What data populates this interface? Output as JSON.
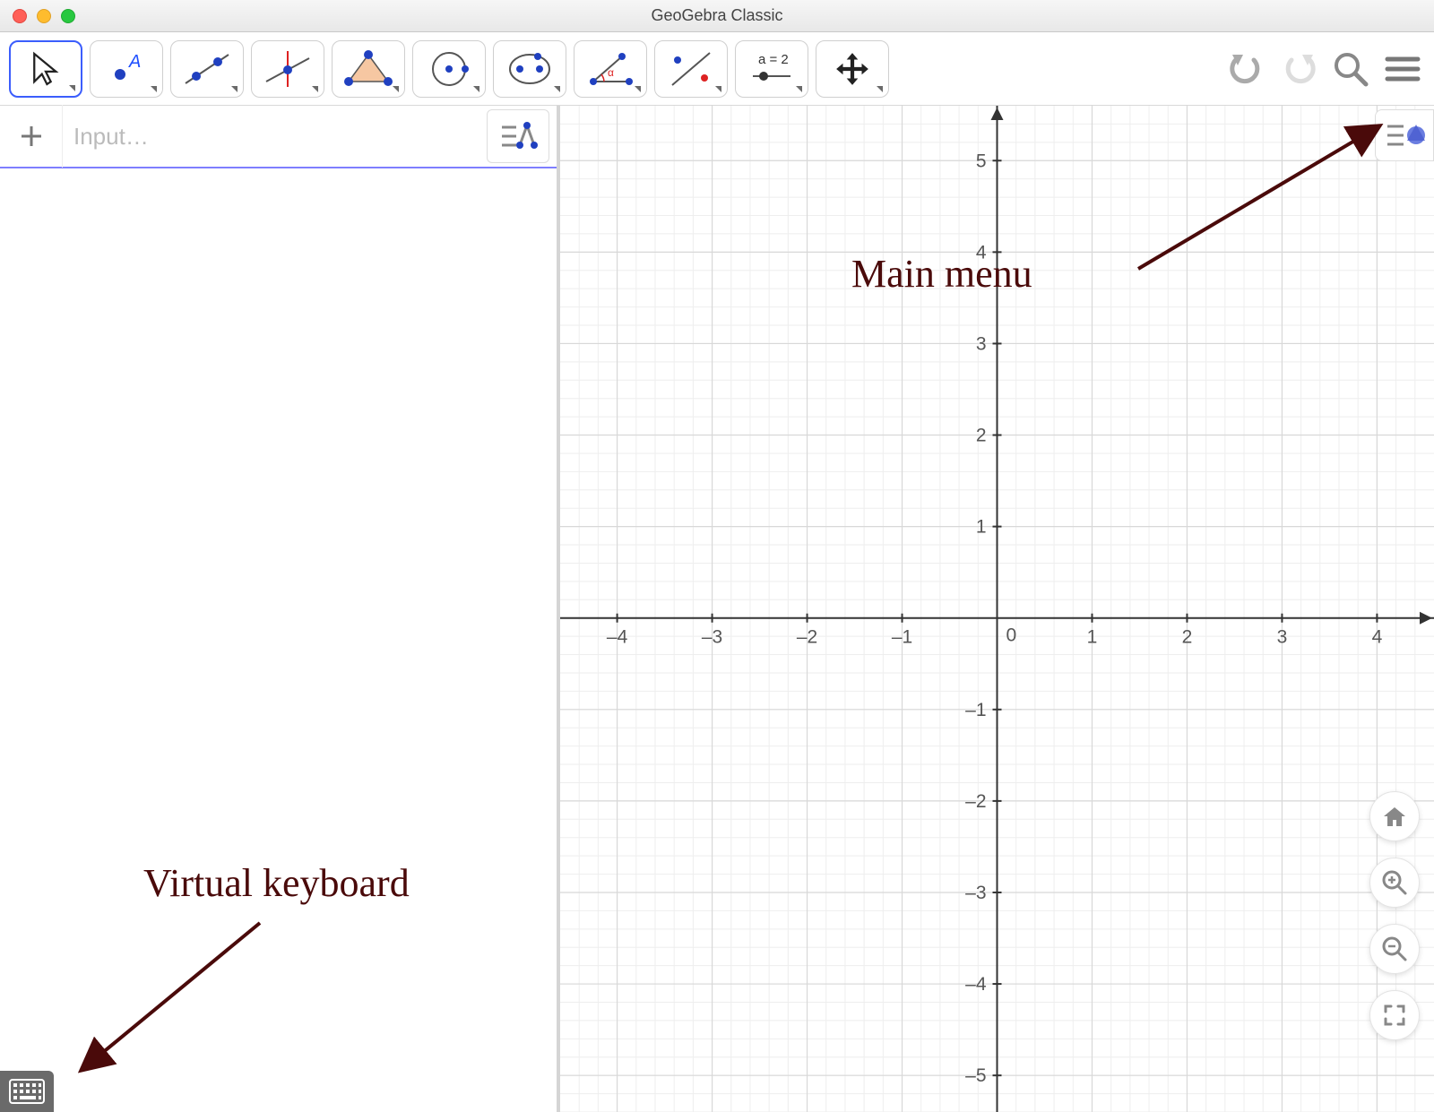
{
  "window": {
    "title": "GeoGebra Classic"
  },
  "toolbar": {
    "tools": [
      {
        "name": "move-tool",
        "active": true
      },
      {
        "name": "point-tool"
      },
      {
        "name": "line-tool"
      },
      {
        "name": "perpendicular-line-tool"
      },
      {
        "name": "polygon-tool"
      },
      {
        "name": "circle-tool"
      },
      {
        "name": "ellipse-tool"
      },
      {
        "name": "angle-tool"
      },
      {
        "name": "reflect-tool"
      },
      {
        "name": "slider-tool",
        "label": "a = 2"
      },
      {
        "name": "move-graphics-tool"
      }
    ]
  },
  "algebra": {
    "input_placeholder": "Input…"
  },
  "graphics": {
    "x_ticks": [
      -4,
      -3,
      -2,
      -1,
      0,
      1,
      2,
      3,
      4
    ],
    "y_ticks": [
      5,
      4,
      3,
      2,
      1,
      -1,
      -2,
      -3,
      -4,
      -5
    ],
    "x_range": [
      -4.6,
      4.6
    ],
    "y_range": [
      -5.4,
      5.6
    ],
    "origin_label": "0"
  },
  "annotations": {
    "main_menu": "Main menu",
    "virtual_keyboard": "Virtual keyboard"
  },
  "icons": {
    "undo": "undo-icon",
    "redo": "redo-icon",
    "search": "search-icon",
    "menu": "hamburger-icon"
  }
}
